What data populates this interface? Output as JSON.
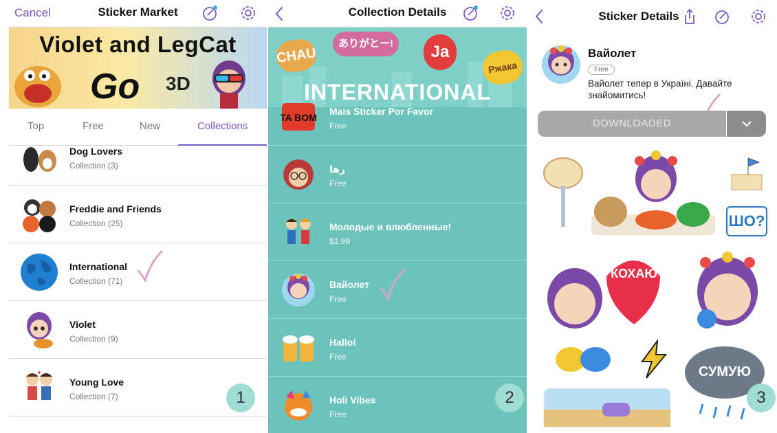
{
  "panel1": {
    "nav": {
      "left": "Cancel",
      "title": "Sticker Market"
    },
    "banner": {
      "title": "Violet and LegCat",
      "sub": "Go",
      "sub3d": "3D"
    },
    "tabs": [
      "Top",
      "Free",
      "New",
      "Collections"
    ],
    "rows": [
      {
        "name": "Dog Lovers",
        "sub": "Collection (3)"
      },
      {
        "name": "Freddie and Friends",
        "sub": "Collection (25)"
      },
      {
        "name": "International",
        "sub": "Collection (71)"
      },
      {
        "name": "Violet",
        "sub": "Collection (9)"
      },
      {
        "name": "Young Love",
        "sub": "Collection (7)"
      }
    ],
    "step": "1"
  },
  "panel2": {
    "nav": {
      "title": "Collection Details"
    },
    "hero": {
      "title": "INTERNATIONAL",
      "b1": "CHAU",
      "b2": "ありがとー!",
      "b3": "Ja",
      "b4": "Ржака"
    },
    "rows": [
      {
        "name": "Mais Sticker Por Favor",
        "sub": "Free",
        "thumb": "TA BOM"
      },
      {
        "name": "رها",
        "sub": "Free"
      },
      {
        "name": "Молодые и влюбленные!",
        "sub": "$1.99"
      },
      {
        "name": "Вайолет",
        "sub": "Free"
      },
      {
        "name": "Hallo!",
        "sub": "Free"
      },
      {
        "name": "Holi Vibes",
        "sub": "Free"
      }
    ],
    "step": "2"
  },
  "panel3": {
    "nav": {
      "title": "Sticker Details"
    },
    "pack": {
      "name": "Вайолет",
      "price": "Free",
      "desc": "Вайолет тепер в Україні. Давайте знайомитись!"
    },
    "button": "DOWNLOADED",
    "stickers": {
      "sho": "ШО?",
      "kohayu": "КОХАЮ",
      "sumuyu": "СУМУЮ"
    },
    "step": "3"
  },
  "colors": {
    "accent": "#7a59c2",
    "teal": "#6cc3bb",
    "check": "#d8a5c8",
    "badge": "#9fdcd3"
  }
}
